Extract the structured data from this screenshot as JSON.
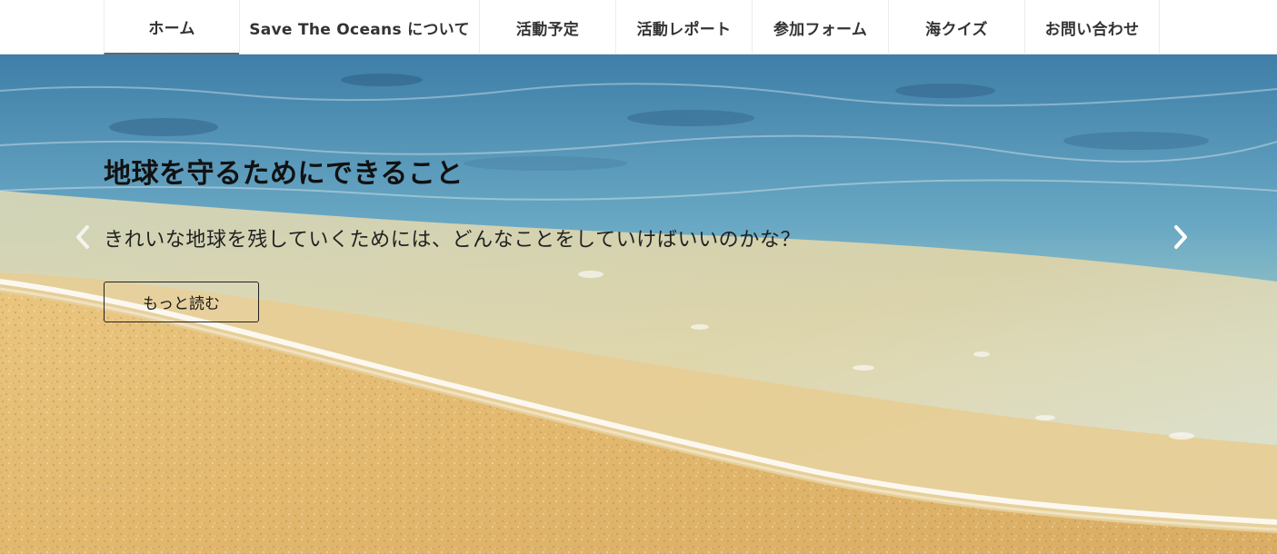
{
  "nav": {
    "items": [
      {
        "label": "ホーム",
        "active": true
      },
      {
        "label": "Save The Oceans について"
      },
      {
        "label": "活動予定"
      },
      {
        "label": "活動レポート"
      },
      {
        "label": "参加フォーム"
      },
      {
        "label": "海クイズ"
      },
      {
        "label": "お問い合わせ"
      }
    ]
  },
  "hero": {
    "title": "地球を守るためにできること",
    "text": "きれいな地球を残していくためには、どんなことをしていけばいいのかな？",
    "button_label": "もっと読む",
    "prev_icon": "chevron-left-icon",
    "next_icon": "chevron-right-icon"
  },
  "colors": {
    "sea_deep": "#4f8fb8",
    "sea_light": "#8cc6d8",
    "shallow": "#d9e3c2",
    "sand": "#e6c07c",
    "nav_text": "#333333"
  }
}
